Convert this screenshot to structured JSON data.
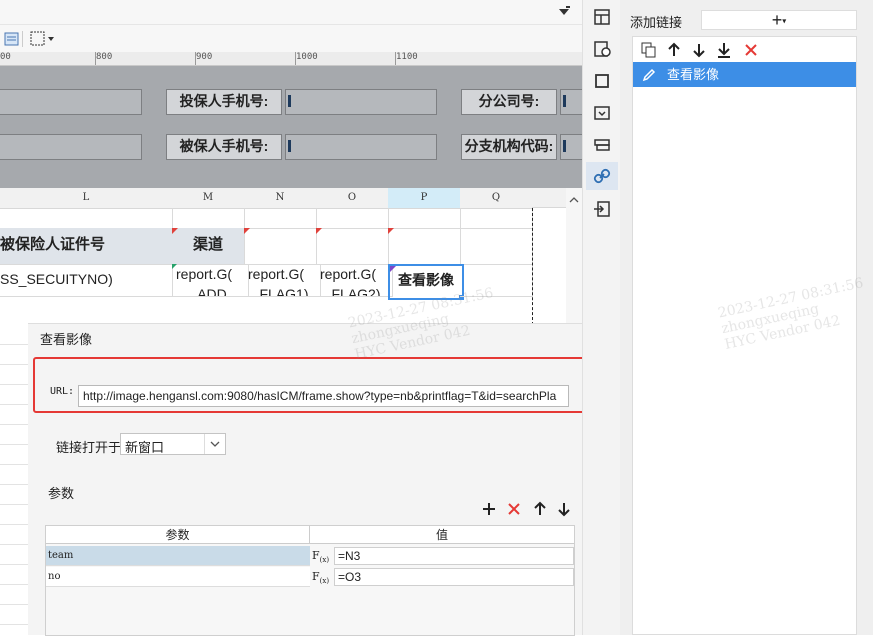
{
  "ruler": {
    "ticks": [
      "800",
      "900",
      "1000",
      "1100"
    ]
  },
  "form": {
    "applicant_phone_label": "投保人手机号:",
    "insured_phone_label": "被保人手机号:",
    "branch_label": "分公司号:",
    "branch_org_label": "分支机构代码:"
  },
  "grid": {
    "columns": [
      "L",
      "M",
      "N",
      "O",
      "P",
      "Q"
    ],
    "row1": {
      "L": "被保险人证件号",
      "M": "渠道"
    },
    "row2": {
      "L": "SS_SECUITYNO)",
      "M": "report.G(",
      "N": "report.G(",
      "O": "report.G(",
      "P": "查看影像"
    },
    "row3": {
      "M": "ADD",
      "N": "FLAG1)",
      "O": "FLAG2)"
    }
  },
  "right_panel": {
    "add_link_label": "添加链接",
    "add_button": "+",
    "links": [
      "查看影像"
    ]
  },
  "dialog": {
    "title": "查看影像",
    "url_label": "URL:",
    "url_value": "http://image.hengansl.com:9080/hasICM/frame.show?type=nb&printflag=T&id=searchPla",
    "open_in_label": "链接打开于",
    "open_in_value": "新窗口",
    "params_label": "参数",
    "params_table": {
      "headers": [
        "参数",
        "值"
      ],
      "rows": [
        {
          "name": "team",
          "value": "=N3"
        },
        {
          "name": "no",
          "value": "=O3"
        }
      ]
    }
  },
  "watermark": {
    "lines": [
      "2023-12-27 08:31:56",
      "zhongxueqing",
      "HYC Vendor 042"
    ]
  },
  "colors": {
    "accent_blue": "#3d8ee6",
    "selection": "#cfe4f7",
    "highlight_red": "#e53935",
    "form_bg": "#a6a9ad"
  }
}
